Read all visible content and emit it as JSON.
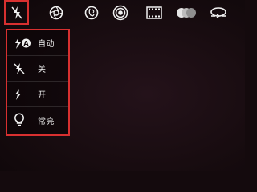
{
  "toolbar": {
    "items": [
      {
        "icon": "flash-off-icon"
      },
      {
        "icon": "shutter-icon"
      },
      {
        "icon": "beauty-face-icon"
      },
      {
        "icon": "capture-mode-icon"
      },
      {
        "icon": "film-icon"
      },
      {
        "icon": "color-filter-icon"
      },
      {
        "icon": "switch-camera-icon"
      }
    ]
  },
  "flash_menu": {
    "items": [
      {
        "label": "自动",
        "icon": "flash-auto-icon"
      },
      {
        "label": "关",
        "icon": "flash-off-icon"
      },
      {
        "label": "开",
        "icon": "flash-on-icon"
      },
      {
        "label": "常亮",
        "icon": "bulb-icon"
      }
    ]
  },
  "colors": {
    "highlight": "#d83030",
    "background": "#180c10",
    "icon": "#f0f0f0"
  }
}
